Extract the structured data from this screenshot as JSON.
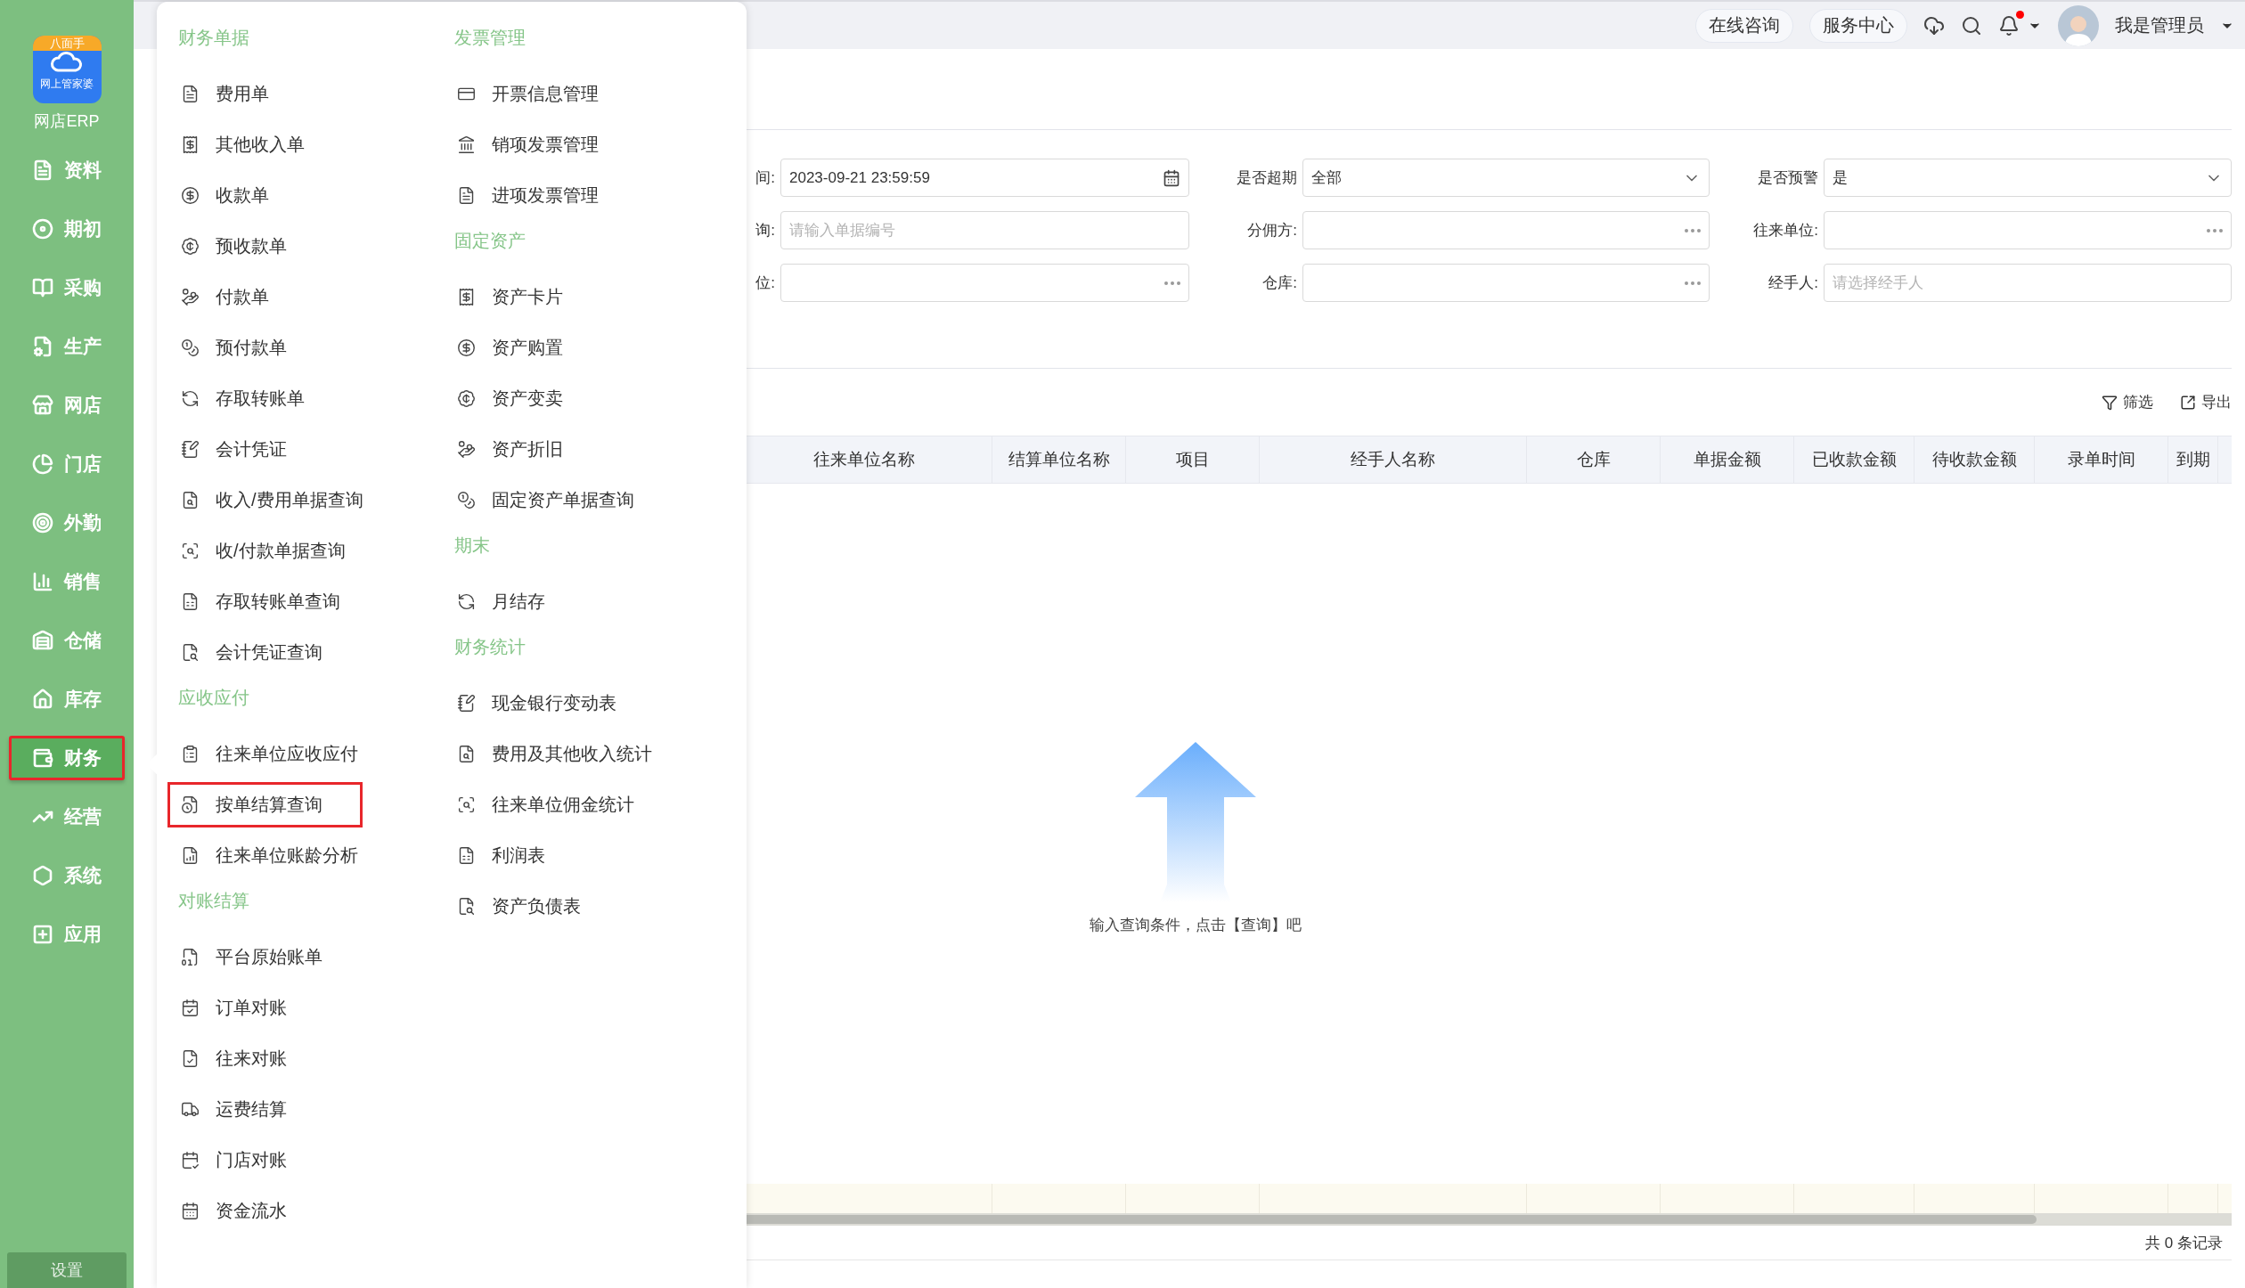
{
  "sidebar": {
    "logo_badge": "八面手",
    "logo_caption": "网上管家婆",
    "app_name": "网店ERP",
    "items": [
      {
        "label": "资料",
        "selected": false,
        "highlighted": false
      },
      {
        "label": "期初",
        "selected": false,
        "highlighted": false
      },
      {
        "label": "采购",
        "selected": false,
        "highlighted": false
      },
      {
        "label": "生产",
        "selected": false,
        "highlighted": false
      },
      {
        "label": "网店",
        "selected": false,
        "highlighted": false
      },
      {
        "label": "门店",
        "selected": false,
        "highlighted": false
      },
      {
        "label": "外勤",
        "selected": false,
        "highlighted": false
      },
      {
        "label": "销售",
        "selected": false,
        "highlighted": false
      },
      {
        "label": "仓储",
        "selected": false,
        "highlighted": false
      },
      {
        "label": "库存",
        "selected": false,
        "highlighted": false
      },
      {
        "label": "财务",
        "selected": true,
        "highlighted": true
      },
      {
        "label": "经营",
        "selected": false,
        "highlighted": false
      },
      {
        "label": "系统",
        "selected": false,
        "highlighted": false
      },
      {
        "label": "应用",
        "selected": false,
        "highlighted": false
      }
    ],
    "settings": "设置"
  },
  "topbar": {
    "buttons": [
      "在线咨询",
      "服务中心"
    ],
    "has_notification": true,
    "user": "我是管理员"
  },
  "menu": {
    "columns": [
      [
        {
          "kind": "header",
          "label": "财务单据"
        },
        {
          "kind": "item",
          "label": "费用单",
          "highlighted": false
        },
        {
          "kind": "item",
          "label": "其他收入单",
          "highlighted": false
        },
        {
          "kind": "item",
          "label": "收款单",
          "highlighted": false
        },
        {
          "kind": "item",
          "label": "预收款单",
          "highlighted": false
        },
        {
          "kind": "item",
          "label": "付款单",
          "highlighted": false
        },
        {
          "kind": "item",
          "label": "预付款单",
          "highlighted": false
        },
        {
          "kind": "item",
          "label": "存取转账单",
          "highlighted": false
        },
        {
          "kind": "item",
          "label": "会计凭证",
          "highlighted": false
        },
        {
          "kind": "item",
          "label": "收入/费用单据查询",
          "highlighted": false
        },
        {
          "kind": "item",
          "label": "收/付款单据查询",
          "highlighted": false
        },
        {
          "kind": "item",
          "label": "存取转账单查询",
          "highlighted": false
        },
        {
          "kind": "item",
          "label": "会计凭证查询",
          "highlighted": false
        },
        {
          "kind": "header",
          "label": "应收应付"
        },
        {
          "kind": "item",
          "label": "往来单位应收应付",
          "highlighted": false
        },
        {
          "kind": "item",
          "label": "按单结算查询",
          "highlighted": true
        },
        {
          "kind": "item",
          "label": "往来单位账龄分析",
          "highlighted": false
        },
        {
          "kind": "header",
          "label": "对账结算"
        },
        {
          "kind": "item",
          "label": "平台原始账单",
          "highlighted": false
        },
        {
          "kind": "item",
          "label": "订单对账",
          "highlighted": false
        },
        {
          "kind": "item",
          "label": "往来对账",
          "highlighted": false
        },
        {
          "kind": "item",
          "label": "运费结算",
          "highlighted": false
        },
        {
          "kind": "item",
          "label": "门店对账",
          "highlighted": false
        },
        {
          "kind": "item",
          "label": "资金流水",
          "highlighted": false
        }
      ],
      [
        {
          "kind": "header",
          "label": "发票管理"
        },
        {
          "kind": "item",
          "label": "开票信息管理",
          "highlighted": false
        },
        {
          "kind": "item",
          "label": "销项发票管理",
          "highlighted": false
        },
        {
          "kind": "item",
          "label": "进项发票管理",
          "highlighted": false
        },
        {
          "kind": "header",
          "label": "固定资产"
        },
        {
          "kind": "item",
          "label": "资产卡片",
          "highlighted": false
        },
        {
          "kind": "item",
          "label": "资产购置",
          "highlighted": false
        },
        {
          "kind": "item",
          "label": "资产变卖",
          "highlighted": false
        },
        {
          "kind": "item",
          "label": "资产折旧",
          "highlighted": false
        },
        {
          "kind": "item",
          "label": "固定资产单据查询",
          "highlighted": false
        },
        {
          "kind": "header",
          "label": "期末"
        },
        {
          "kind": "item",
          "label": "月结存",
          "highlighted": false
        },
        {
          "kind": "header",
          "label": "财务统计"
        },
        {
          "kind": "item",
          "label": "现金银行变动表",
          "highlighted": false
        },
        {
          "kind": "item",
          "label": "费用及其他收入统计",
          "highlighted": false
        },
        {
          "kind": "item",
          "label": "往来单位佣金统计",
          "highlighted": false
        },
        {
          "kind": "item",
          "label": "利润表",
          "highlighted": false
        },
        {
          "kind": "item",
          "label": "资产负债表",
          "highlighted": false
        }
      ]
    ]
  },
  "filters": [
    {
      "kind": "date",
      "label": "间:",
      "value": "2023-09-21 23:59:59"
    },
    {
      "kind": "select",
      "label": "是否超期",
      "value": "全部"
    },
    {
      "kind": "select",
      "label": "是否预警",
      "value": "是"
    },
    {
      "kind": "text",
      "label": "询:",
      "placeholder": "请输入单据编号"
    },
    {
      "kind": "picker",
      "label": "分佣方:"
    },
    {
      "kind": "picker",
      "label": "往来单位:"
    },
    {
      "kind": "picker",
      "label": "位:"
    },
    {
      "kind": "picker",
      "label": "仓库:"
    },
    {
      "kind": "text",
      "label": "经手人:",
      "placeholder": "请选择经手人"
    }
  ],
  "toolbar": [
    "筛选",
    "导出"
  ],
  "table": {
    "columns": [
      "往来单位名称",
      "结算单位名称",
      "项目",
      "经手人名称",
      "仓库",
      "单据金额",
      "已收款金额",
      "待收款金额",
      "录单时间",
      "到期"
    ],
    "empty_message": "输入查询条件，点击【查询】吧",
    "record_count": "共 0 条记录"
  }
}
